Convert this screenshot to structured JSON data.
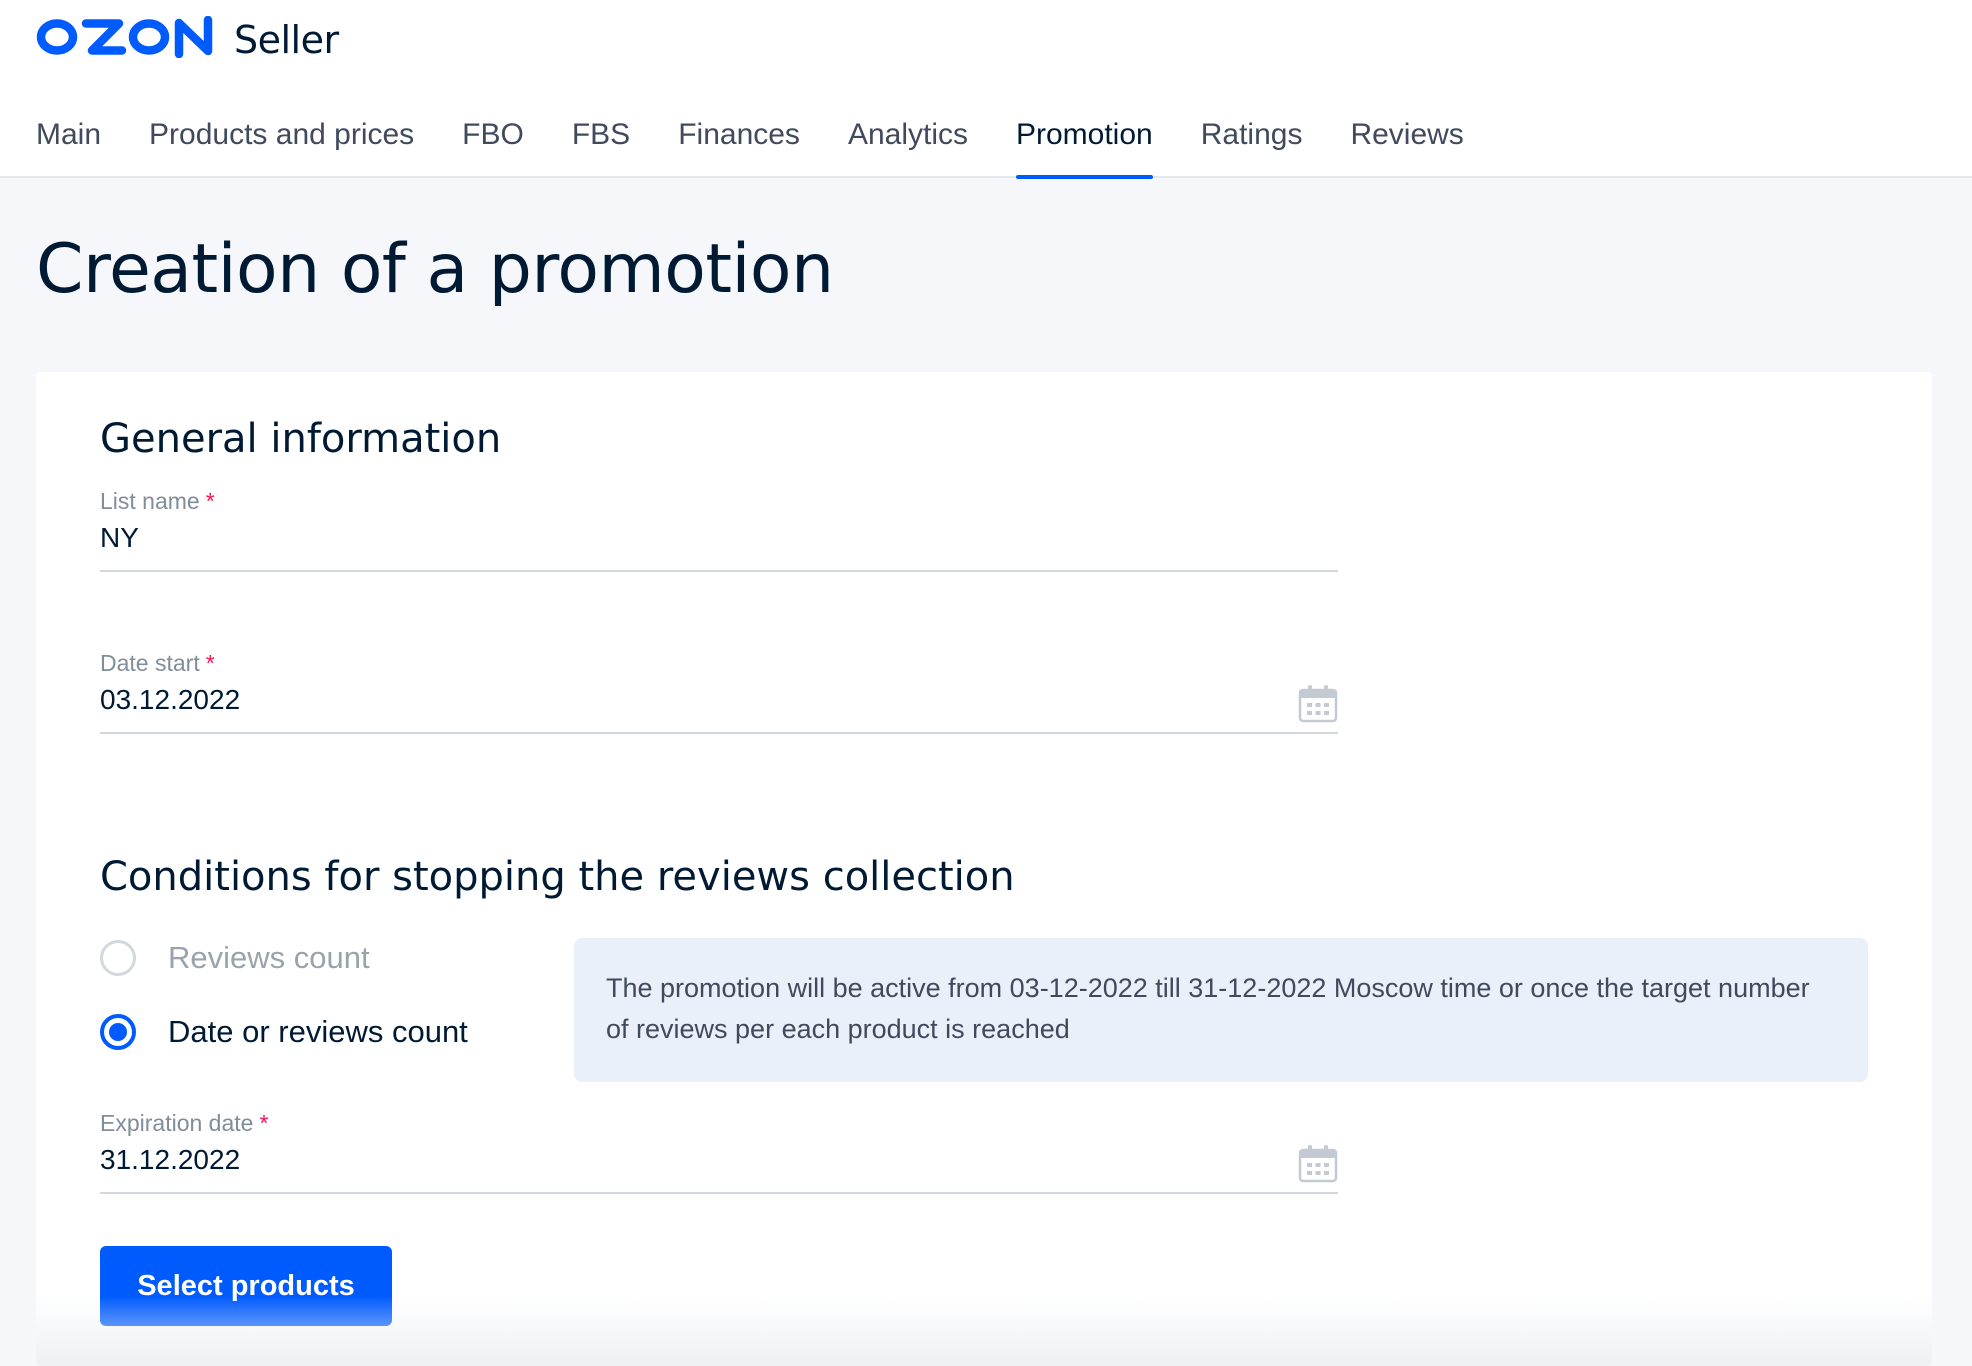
{
  "brand": {
    "logo_text": "OZON",
    "product": "Seller",
    "color": "#005bff"
  },
  "nav": {
    "items": [
      {
        "label": "Main"
      },
      {
        "label": "Products and prices"
      },
      {
        "label": "FBO"
      },
      {
        "label": "FBS"
      },
      {
        "label": "Finances"
      },
      {
        "label": "Analytics"
      },
      {
        "label": "Promotion",
        "active": true
      },
      {
        "label": "Ratings"
      },
      {
        "label": "Reviews"
      }
    ]
  },
  "page": {
    "title": "Creation of a promotion"
  },
  "general": {
    "title": "General information",
    "list_name": {
      "label": "List name",
      "value": "NY",
      "required": "*"
    },
    "date_start": {
      "label": "Date start",
      "value": "03.12.2022",
      "required": "*",
      "icon": "calendar-icon"
    }
  },
  "conditions": {
    "title": "Conditions for stopping the reviews collection",
    "options": [
      {
        "label": "Reviews count",
        "checked": false
      },
      {
        "label": "Date or reviews count",
        "checked": true
      }
    ],
    "info": "The promotion will be active from 03-12-2022 till 31-12-2022 Moscow time or once the target number of reviews per each product is reached",
    "expiration": {
      "label": "Expiration date",
      "value": "31.12.2022",
      "required": "*",
      "icon": "calendar-icon"
    }
  },
  "actions": {
    "select_products": "Select products"
  },
  "colors": {
    "accent": "#005bff",
    "required": "#f91155",
    "info_bg": "#eaf0fa"
  }
}
